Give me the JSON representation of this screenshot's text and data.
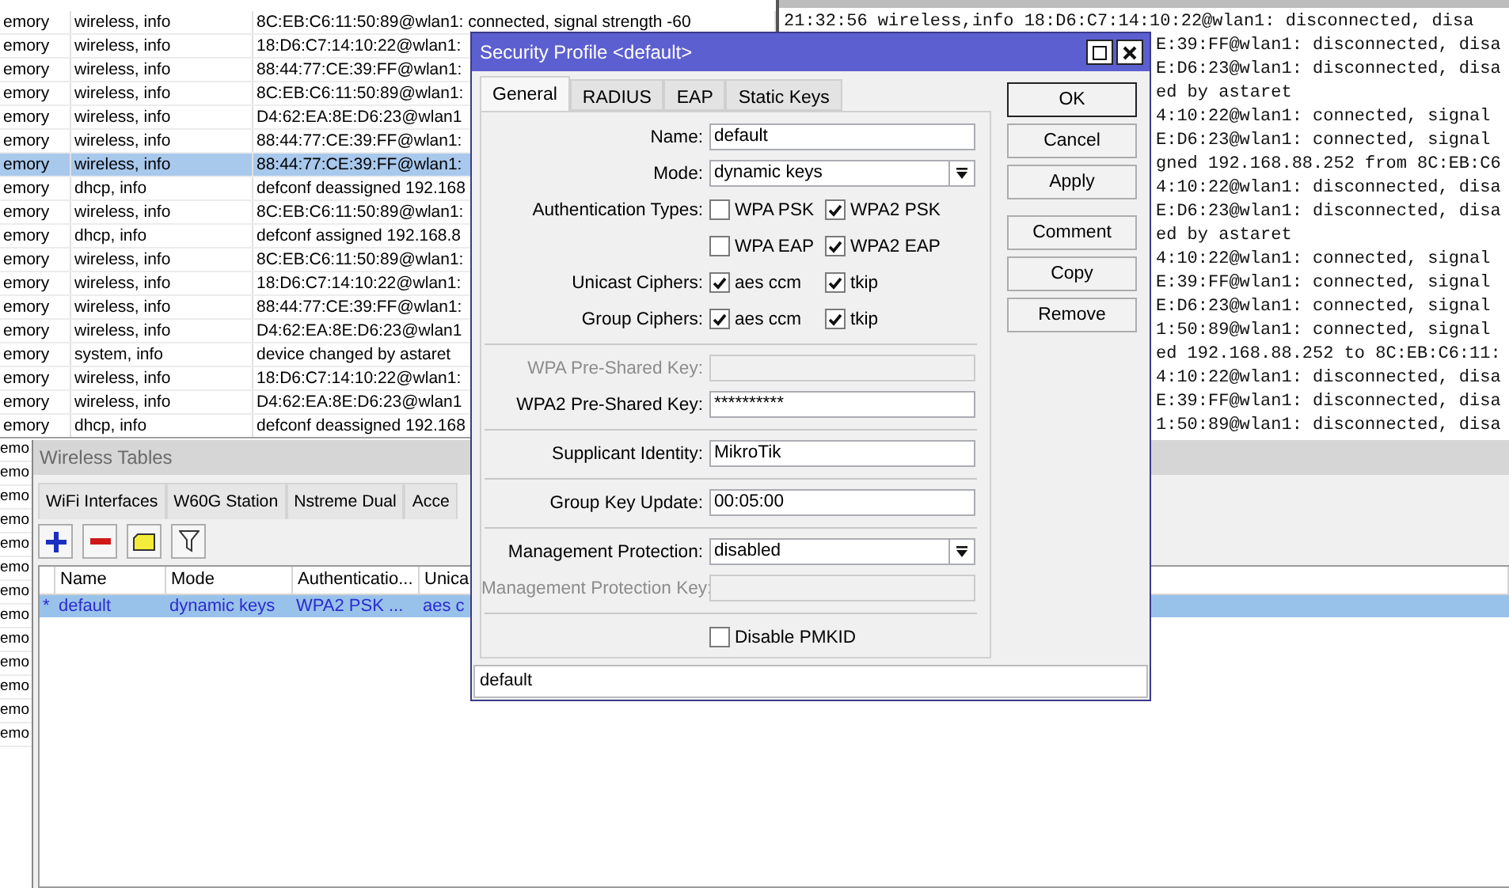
{
  "log_window": {
    "rows": [
      {
        "buffer": "emory",
        "topics": "wireless, info",
        "message": "8C:EB:C6:11:50:89@wlan1: connected, signal strength -60",
        "selected": false
      },
      {
        "buffer": "emory",
        "topics": "wireless, info",
        "message": "18:D6:C7:14:10:22@wlan1:",
        "selected": false
      },
      {
        "buffer": "emory",
        "topics": "wireless, info",
        "message": "88:44:77:CE:39:FF@wlan1:",
        "selected": false
      },
      {
        "buffer": "emory",
        "topics": "wireless, info",
        "message": "8C:EB:C6:11:50:89@wlan1:",
        "selected": false
      },
      {
        "buffer": "emory",
        "topics": "wireless, info",
        "message": "D4:62:EA:8E:D6:23@wlan1",
        "selected": false
      },
      {
        "buffer": "emory",
        "topics": "wireless, info",
        "message": "88:44:77:CE:39:FF@wlan1:",
        "selected": false
      },
      {
        "buffer": "emory",
        "topics": "wireless, info",
        "message": "88:44:77:CE:39:FF@wlan1:",
        "selected": true
      },
      {
        "buffer": "emory",
        "topics": "dhcp, info",
        "message": "defconf deassigned 192.168",
        "selected": false
      },
      {
        "buffer": "emory",
        "topics": "wireless, info",
        "message": "8C:EB:C6:11:50:89@wlan1:",
        "selected": false
      },
      {
        "buffer": "emory",
        "topics": "dhcp, info",
        "message": "defconf assigned 192.168.8",
        "selected": false
      },
      {
        "buffer": "emory",
        "topics": "wireless, info",
        "message": "8C:EB:C6:11:50:89@wlan1:",
        "selected": false
      },
      {
        "buffer": "emory",
        "topics": "wireless, info",
        "message": "18:D6:C7:14:10:22@wlan1:",
        "selected": false
      },
      {
        "buffer": "emory",
        "topics": "wireless, info",
        "message": "88:44:77:CE:39:FF@wlan1:",
        "selected": false
      },
      {
        "buffer": "emory",
        "topics": "wireless, info",
        "message": "D4:62:EA:8E:D6:23@wlan1",
        "selected": false
      },
      {
        "buffer": "emory",
        "topics": "system, info",
        "message": "device changed by astaret",
        "selected": false
      },
      {
        "buffer": "emory",
        "topics": "wireless, info",
        "message": "18:D6:C7:14:10:22@wlan1:",
        "selected": false
      },
      {
        "buffer": "emory",
        "topics": "wireless, info",
        "message": "D4:62:EA:8E:D6:23@wlan1",
        "selected": false
      },
      {
        "buffer": "emory",
        "topics": "dhcp, info",
        "message": "defconf deassigned 192.168",
        "selected": false
      }
    ]
  },
  "back_log": {
    "rows": [
      "emo",
      "emo",
      "emo",
      "emo",
      "emo",
      "emo",
      "emo",
      "emo",
      "emo",
      "emo",
      "emo",
      "emo",
      "emo"
    ]
  },
  "terminal": {
    "lines": [
      "21:32:56 wireless,info 18:D6:C7:14:10:22@wlan1: disconnected, disa",
      "E:39:FF@wlan1: disconnected, disa",
      "E:D6:23@wlan1: disconnected, disa",
      "ed by astaret",
      "4:10:22@wlan1: connected, signal",
      "E:D6:23@wlan1: connected, signal",
      "gned 192.168.88.252 from 8C:EB:C6",
      "4:10:22@wlan1: disconnected, disa",
      "E:D6:23@wlan1: disconnected, disa",
      "ed by astaret",
      "4:10:22@wlan1: connected, signal",
      "E:39:FF@wlan1: connected, signal",
      "E:D6:23@wlan1: connected, signal",
      "1:50:89@wlan1: connected, signal",
      "ed 192.168.88.252 to 8C:EB:C6:11:",
      "4:10:22@wlan1: disconnected, disa",
      "E:39:FF@wlan1: disconnected, disa",
      "1:50:89@wlan1: disconnected, disa"
    ]
  },
  "wireless_tables": {
    "title": "Wireless Tables",
    "tabs": [
      {
        "label": "WiFi Interfaces",
        "selected": false
      },
      {
        "label": "W60G Station",
        "selected": false
      },
      {
        "label": "Nstreme Dual",
        "selected": false
      },
      {
        "label": "Acce",
        "selected": false
      }
    ],
    "columns": [
      "Name",
      "Mode",
      "Authenticatio...",
      "Unica"
    ],
    "rows": [
      {
        "marker": "*",
        "cells": [
          "default",
          "dynamic keys",
          "WPA2 PSK ...",
          "aes c"
        ],
        "selected": true
      }
    ]
  },
  "dialog": {
    "title": "Security Profile <default>",
    "tabs": [
      {
        "label": "General",
        "selected": true
      },
      {
        "label": "RADIUS",
        "selected": false
      },
      {
        "label": "EAP",
        "selected": false
      },
      {
        "label": "Static Keys",
        "selected": false
      }
    ],
    "fields": [
      {
        "kind": "text",
        "label": "Name:",
        "value": "default",
        "disabled": false
      },
      {
        "kind": "select",
        "label": "Mode:",
        "value": "dynamic keys",
        "disabled": false
      },
      {
        "kind": "checks",
        "label": "Authentication Types:",
        "options": [
          {
            "label": "WPA PSK",
            "checked": false
          },
          {
            "label": "WPA2 PSK",
            "checked": true
          }
        ]
      },
      {
        "kind": "checks",
        "options": [
          {
            "label": "WPA EAP",
            "checked": false
          },
          {
            "label": "WPA2 EAP",
            "checked": true
          }
        ]
      },
      {
        "kind": "checks",
        "label": "Unicast Ciphers:",
        "options": [
          {
            "label": "aes ccm",
            "checked": true
          },
          {
            "label": "tkip",
            "checked": true
          }
        ]
      },
      {
        "kind": "checks",
        "label": "Group Ciphers:",
        "options": [
          {
            "label": "aes ccm",
            "checked": true
          },
          {
            "label": "tkip",
            "checked": true
          }
        ]
      },
      {
        "kind": "separator"
      },
      {
        "kind": "text",
        "label": "WPA Pre-Shared Key:",
        "disabled": true
      },
      {
        "kind": "text",
        "label": "WPA2 Pre-Shared Key:",
        "value": "**********",
        "disabled": false
      },
      {
        "kind": "separator"
      },
      {
        "kind": "text",
        "label": "Supplicant Identity:",
        "value": "MikroTik",
        "disabled": false
      },
      {
        "kind": "separator"
      },
      {
        "kind": "text",
        "label": "Group Key Update:",
        "value": "00:05:00",
        "disabled": false
      },
      {
        "kind": "separator"
      },
      {
        "kind": "select",
        "label": "Management Protection:",
        "value": "disabled",
        "disabled": false
      },
      {
        "kind": "text",
        "label": "Management Protection Key:",
        "disabled": true
      },
      {
        "kind": "separator"
      },
      {
        "kind": "checkbox",
        "label": "Disable PMKID",
        "checked": false
      }
    ],
    "button_groups": [
      [
        {
          "label": "OK",
          "default": true
        },
        {
          "label": "Cancel",
          "default": false
        },
        {
          "label": "Apply",
          "default": false
        }
      ],
      [
        {
          "label": "Comment",
          "default": false
        },
        {
          "label": "Copy",
          "default": false
        },
        {
          "label": "Remove",
          "default": false
        }
      ]
    ],
    "status": "default"
  }
}
